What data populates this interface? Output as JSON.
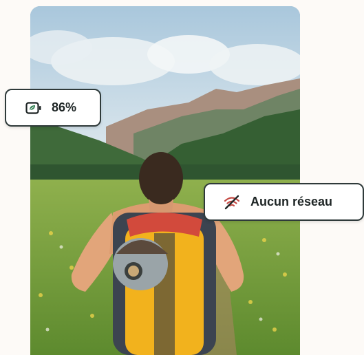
{
  "photo": {
    "description_icon": "photo-icon"
  },
  "battery": {
    "icon": "battery-leaf-icon",
    "value": "86%",
    "accent": "#2e7d4f"
  },
  "network": {
    "icon": "no-signal-icon",
    "label": "Aucun réseau",
    "accent": "#d9534f"
  }
}
